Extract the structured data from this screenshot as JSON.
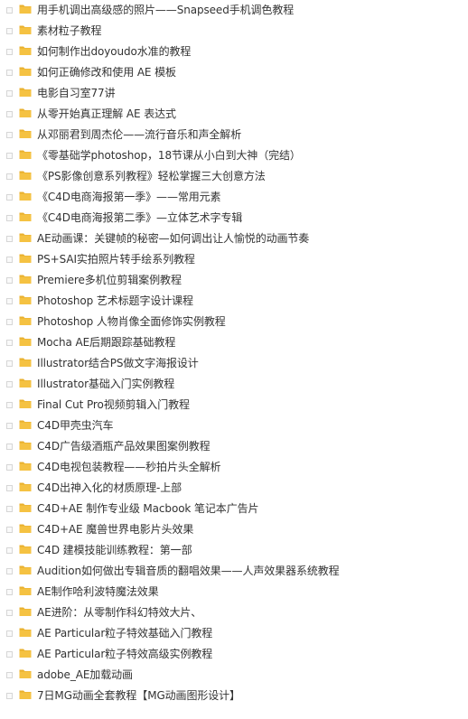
{
  "colors": {
    "folder_fill": "#f5c242",
    "folder_tab": "#e9b02f",
    "text": "#333333"
  },
  "items": [
    {
      "label": "用手机调出高级感的照片——Snapseed手机调色教程",
      "icon": "folder-icon"
    },
    {
      "label": "素材粒子教程",
      "icon": "folder-icon"
    },
    {
      "label": "如何制作出doyoudo水准的教程",
      "icon": "folder-icon"
    },
    {
      "label": "如何正确修改和使用 AE 模板",
      "icon": "folder-icon"
    },
    {
      "label": "电影自习室77讲",
      "icon": "folder-icon"
    },
    {
      "label": "从零开始真正理解 AE 表达式",
      "icon": "folder-icon"
    },
    {
      "label": "从邓丽君到周杰伦——流行音乐和声全解析",
      "icon": "folder-icon"
    },
    {
      "label": "《零基础学photoshop，18节课从小白到大神（完结）",
      "icon": "folder-icon"
    },
    {
      "label": "《PS影像创意系列教程》轻松掌握三大创意方法",
      "icon": "folder-icon"
    },
    {
      "label": "《C4D电商海报第一季》——常用元素",
      "icon": "folder-icon"
    },
    {
      "label": "《C4D电商海报第二季》—立体艺术字专辑",
      "icon": "folder-icon"
    },
    {
      "label": "AE动画课：关键帧的秘密—如何调出让人愉悦的动画节奏",
      "icon": "folder-icon"
    },
    {
      "label": "PS+SAI实拍照片转手绘系列教程",
      "icon": "folder-icon"
    },
    {
      "label": "Premiere多机位剪辑案例教程",
      "icon": "folder-icon"
    },
    {
      "label": "Photoshop 艺术标题字设计课程",
      "icon": "folder-icon"
    },
    {
      "label": "Photoshop 人物肖像全面修饰实例教程",
      "icon": "folder-icon"
    },
    {
      "label": "Mocha AE后期跟踪基础教程",
      "icon": "folder-icon"
    },
    {
      "label": "Illustrator结合PS做文字海报设计",
      "icon": "folder-icon"
    },
    {
      "label": "Illustrator基础入门实例教程",
      "icon": "folder-icon"
    },
    {
      "label": "Final Cut Pro视频剪辑入门教程",
      "icon": "folder-icon"
    },
    {
      "label": "C4D甲壳虫汽车",
      "icon": "folder-icon"
    },
    {
      "label": "C4D广告级酒瓶产品效果图案例教程",
      "icon": "folder-icon"
    },
    {
      "label": "C4D电视包装教程——秒拍片头全解析",
      "icon": "folder-icon"
    },
    {
      "label": "C4D出神入化的材质原理-上部",
      "icon": "folder-icon"
    },
    {
      "label": "C4D+AE 制作专业级 Macbook 笔记本广告片",
      "icon": "folder-icon"
    },
    {
      "label": "C4D+AE 魔兽世界电影片头效果",
      "icon": "folder-icon"
    },
    {
      "label": "C4D 建模技能训练教程：第一部",
      "icon": "folder-icon"
    },
    {
      "label": "Audition如何做出专辑音质的翻唱效果——人声效果器系统教程",
      "icon": "folder-icon"
    },
    {
      "label": "AE制作哈利波特魔法效果",
      "icon": "folder-icon"
    },
    {
      "label": "AE进阶：从零制作科幻特效大片、",
      "icon": "folder-icon"
    },
    {
      "label": "AE Particular粒子特效基础入门教程",
      "icon": "folder-icon"
    },
    {
      "label": "AE Particular粒子特效高级实例教程",
      "icon": "folder-icon"
    },
    {
      "label": "adobe_AE加载动画",
      "icon": "folder-icon"
    },
    {
      "label": "7日MG动画全套教程【MG动画图形设计】",
      "icon": "folder-icon"
    }
  ]
}
